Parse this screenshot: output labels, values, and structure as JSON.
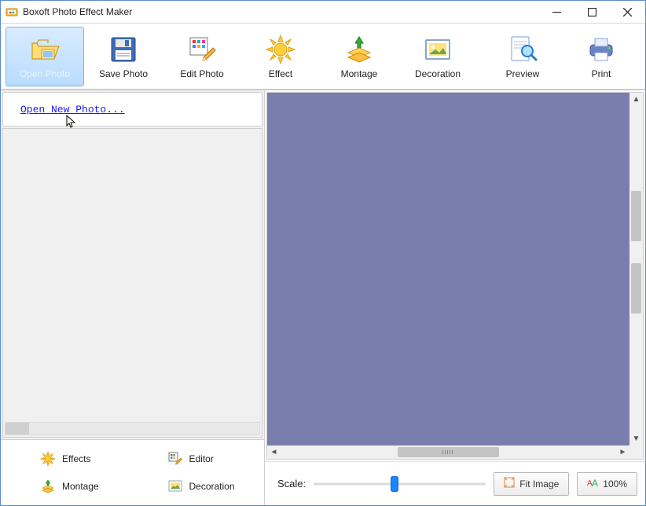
{
  "title": "Boxoft Photo Effect Maker",
  "toolbar": {
    "open_photo": "Open Photo",
    "save_photo": "Save Photo",
    "edit_photo": "Edit Photo",
    "effect": "Effect",
    "montage": "Montage",
    "decoration": "Decoration",
    "preview": "Preview",
    "print": "Print"
  },
  "sidepanel": {
    "open_link": "Open New Photo..."
  },
  "taskpanel": {
    "effects": "Effects",
    "editor": "Editor",
    "montage": "Montage",
    "decoration": "Decoration"
  },
  "bottombar": {
    "scale_label": "Scale:",
    "fit_image": "Fit Image",
    "zoom": "100%"
  },
  "colors": {
    "canvas_bg": "#7a7eac",
    "accent": "#1a86ff"
  }
}
